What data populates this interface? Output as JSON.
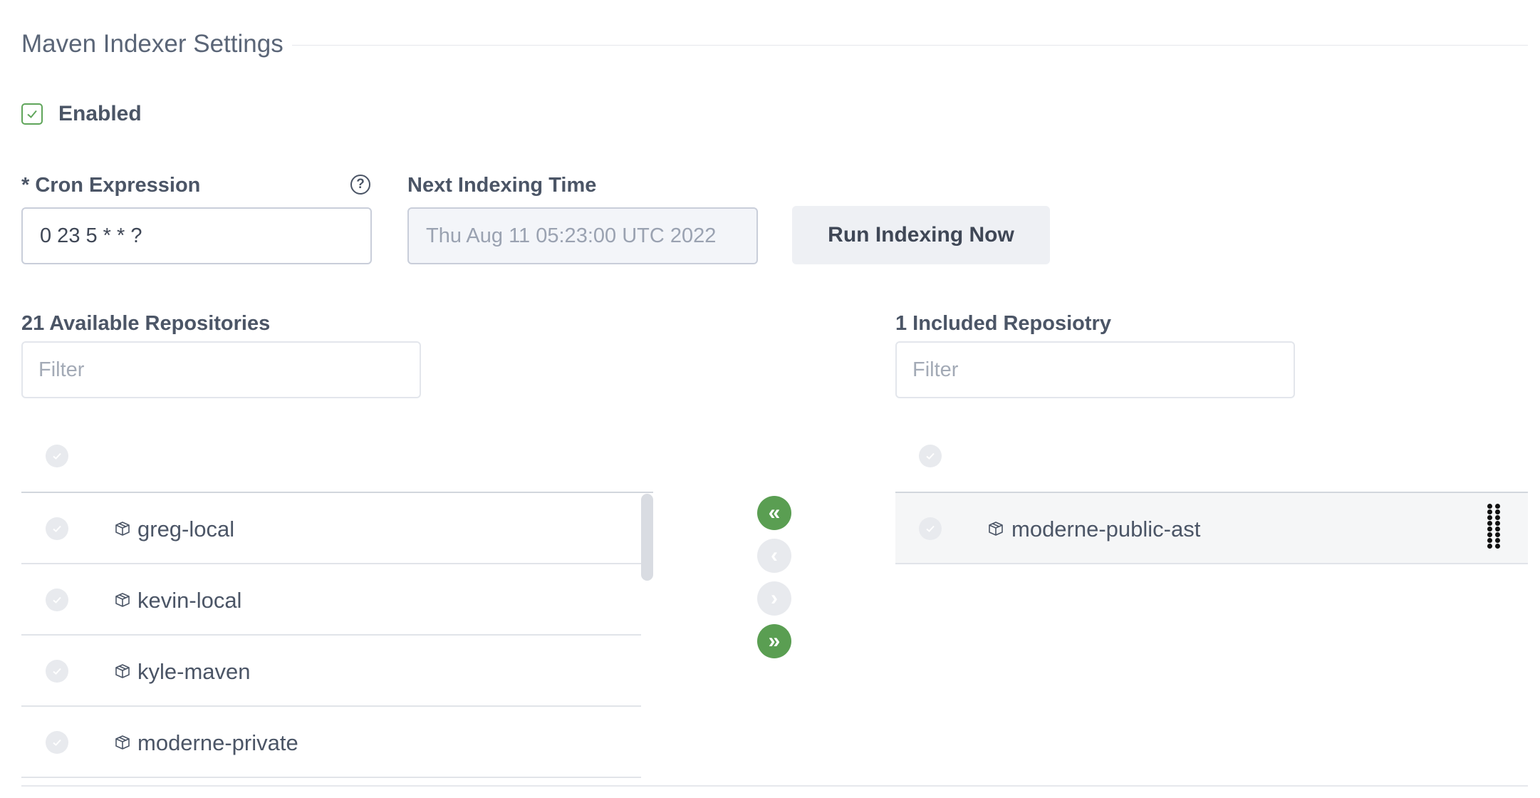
{
  "section": {
    "title": "Maven Indexer Settings"
  },
  "enabled": {
    "label": "Enabled",
    "checked": true
  },
  "cron": {
    "label": "* Cron Expression",
    "value": "0 23 5 * * ?"
  },
  "next_indexing": {
    "label": "Next Indexing Time",
    "value": "Thu Aug 11 05:23:00 UTC 2022"
  },
  "run_button": {
    "label": "Run Indexing Now"
  },
  "available": {
    "heading": "21 Available Repositories",
    "filter_placeholder": "Filter",
    "items": [
      {
        "name": "greg-local"
      },
      {
        "name": "kevin-local"
      },
      {
        "name": "kyle-maven"
      },
      {
        "name": "moderne-private"
      }
    ]
  },
  "included": {
    "heading": "1 Included Reposiotry",
    "filter_placeholder": "Filter",
    "items": [
      {
        "name": "moderne-public-ast"
      }
    ]
  },
  "transfer_buttons": {
    "move_all_left": "«",
    "move_left": "‹",
    "move_right": "›",
    "move_all_right": "»"
  },
  "colors": {
    "accent": "#5a9e52",
    "muted": "#e8eaee"
  }
}
